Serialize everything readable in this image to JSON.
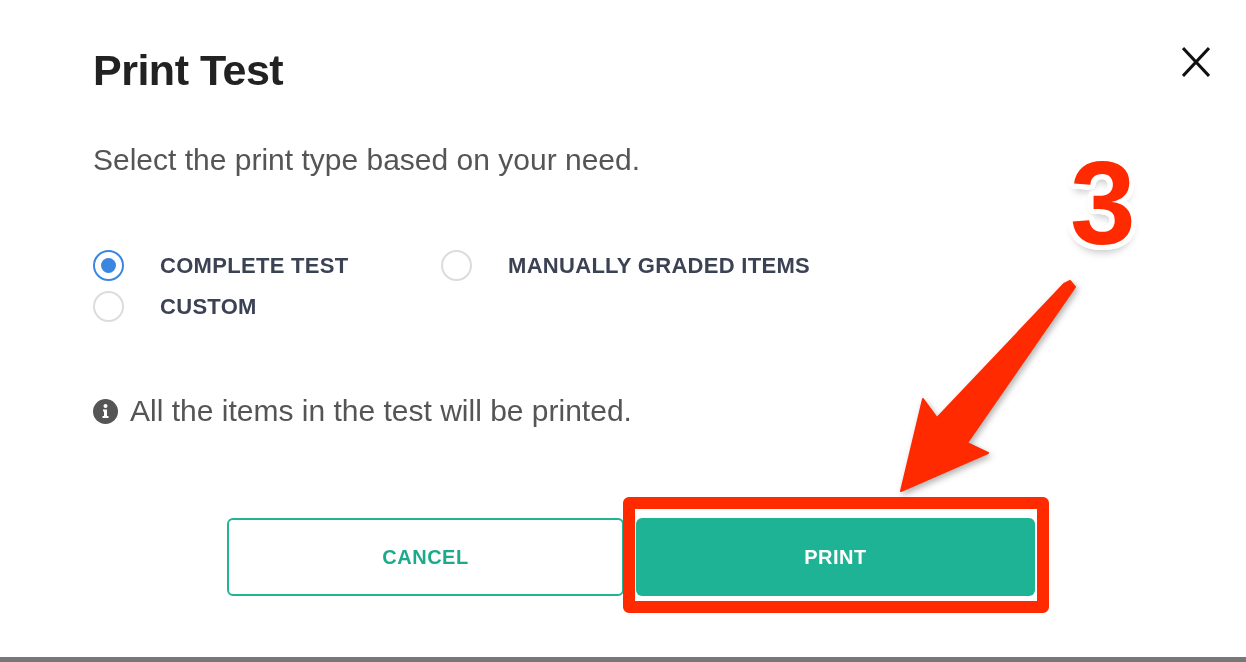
{
  "dialog": {
    "title": "Print Test",
    "instruction": "Select the print type based on your need.",
    "print_types": [
      {
        "label": "COMPLETE TEST",
        "selected": true
      },
      {
        "label": "MANUALLY GRADED ITEMS",
        "selected": false
      },
      {
        "label": "CUSTOM",
        "selected": false
      }
    ],
    "info": "All the items in the test will be printed.",
    "buttons": [
      {
        "label": "CANCEL",
        "kind": "outline",
        "highlighted": false
      },
      {
        "label": "PRINT",
        "kind": "filled",
        "highlighted": true
      }
    ]
  },
  "annotation": {
    "step": "3"
  }
}
